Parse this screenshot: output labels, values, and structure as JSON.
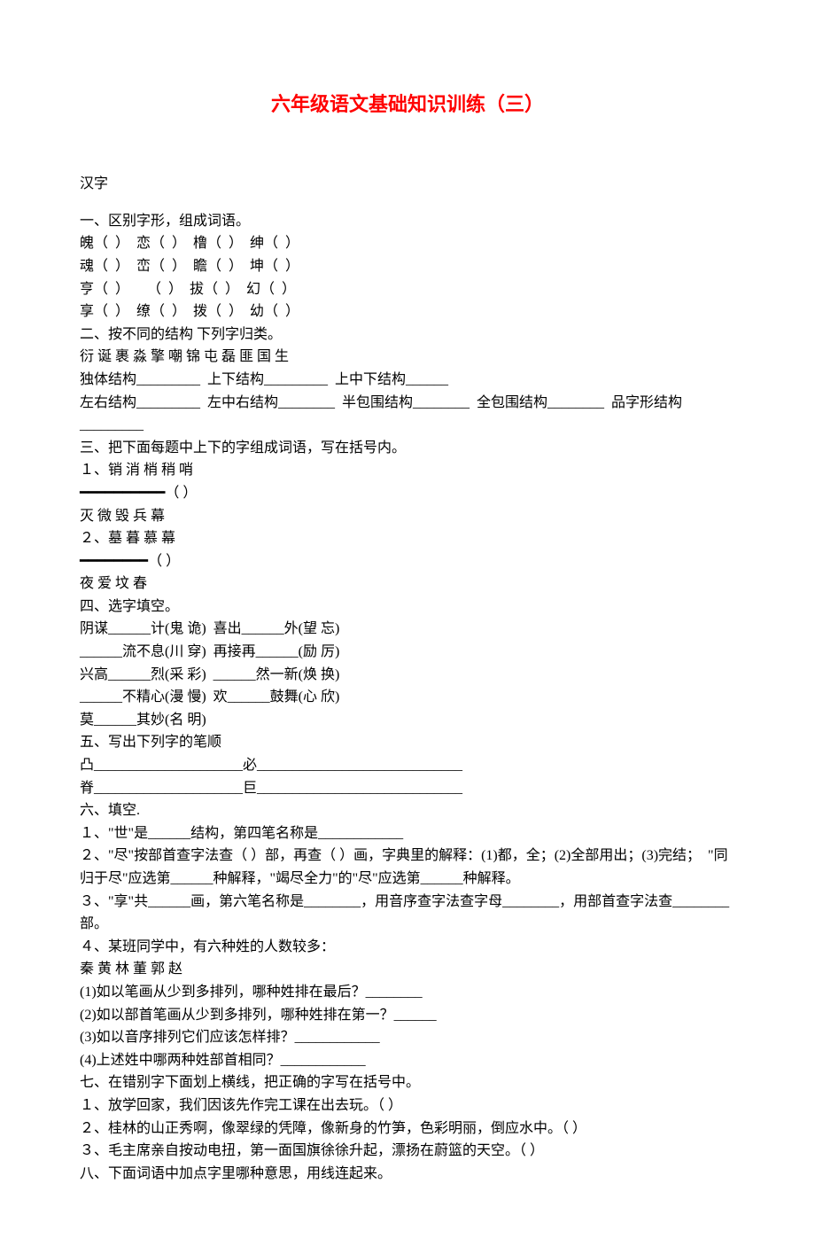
{
  "title": "六年级语文基础知识训练（三）",
  "subject_header": "汉字",
  "sections": {
    "s1": {
      "heading": "一、区别字形，组成词语。",
      "lines": [
        "魄（  ）  恋（  ）  橹（  ）  绅（  ）",
        "魂（  ）  峦（  ）  瞻（  ）  坤（  ）",
        "亨（  ）     （  ）  拔（  ）  幻（  ）",
        "享（  ）  缭（  ）  拨（  ）  幼（  ）"
      ]
    },
    "s2": {
      "heading": "二、按不同的结构 下列字归类。",
      "lines": [
        "衍 诞 裹 淼 擎 嘲 锦 屯 磊 匪 国 生",
        "独体结构_________  上下结构_________  上中下结构______",
        "左右结构_________  左中右结构________  半包围结构________  全包围结构________  品字形结构_________"
      ]
    },
    "s3": {
      "heading": "三、把下面每题中上下的字组成词语，写在括号内。",
      "lines": [
        "１、销 消 梢 稍 哨",
        "━━━━━━━━━━（ ）",
        "灭 微 毁 兵 幕",
        "２、墓 暮 慕 幕",
        "━━━━━━━━（ ）",
        "夜 爱 坟 春"
      ]
    },
    "s4": {
      "heading": "四、选字填空。",
      "lines": [
        "阴谋______计(鬼 诡)  喜出______外(望 忘)",
        "______流不息(川 穿)  再接再______(励 厉)",
        "兴高______烈(采 彩)  ______然一新(焕 换)",
        "______不精心(漫 慢)  欢______鼓舞(心 欣)",
        "莫______其妙(名 明)"
      ]
    },
    "s5": {
      "heading": "五、写出下列字的笔顺",
      "lines": [
        "凸_____________________必_____________________________",
        "脊_____________________巨_____________________________"
      ]
    },
    "s6": {
      "heading": "六、填空.",
      "lines": [
        "１、\"世\"是______结构，第四笔名称是____________",
        "２、\"尽\"按部首查字法查（ ）部，再查（ ）画，字典里的解释：(1)都，全；(2)全部用出；(3)完结；  \"同归于尽\"应选第______种解释，\"竭尽全力\"的\"尽\"应选第______种解释。",
        "３、\"享\"共______画，第六笔名称是________，用音序查字法查字母________，用部首查字法查________部。",
        "４、某班同学中，有六种姓的人数较多：",
        "秦 黄 林 董 郭 赵",
        "(1)如以笔画从少到多排列，哪种姓排在最后？________",
        "(2)如以部首笔画从少到多排列，哪种姓排在第一？______",
        "(3)如以音序排列它们应该怎样排？____________",
        "(4)上述姓中哪两种姓部首相同？____________"
      ]
    },
    "s7": {
      "heading": "七、在错别字下面划上横线，把正确的字写在括号中。",
      "lines": [
        "１、放学回家，我们因该先作完工课在出去玩。（ ）",
        "２、桂林的山正秀啊，像翠绿的凭障，像新身的竹笋，色彩明丽，倒应水中。（ ）",
        "３、毛主席亲自按动电扭，第一面国旗徐徐升起，漂扬在蔚篮的天空。（ ）"
      ]
    },
    "s8": {
      "heading": "八、下面词语中加点字里哪种意思，用线连起来。"
    }
  }
}
